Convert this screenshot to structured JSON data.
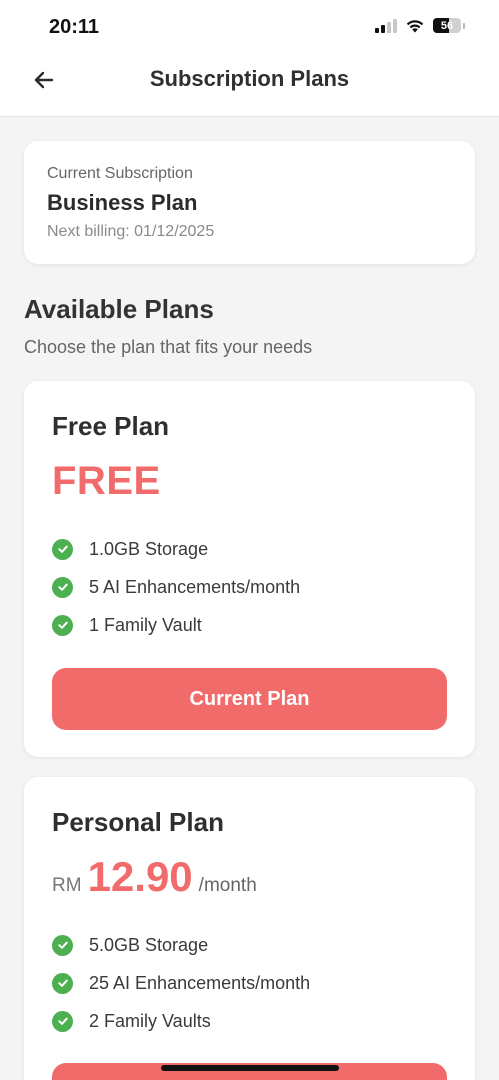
{
  "status_bar": {
    "time": "20:11",
    "battery": "56",
    "battery_level": 0.56
  },
  "header": {
    "title": "Subscription Plans",
    "back_icon": "arrow-left-icon"
  },
  "current_subscription": {
    "label": "Current Subscription",
    "plan": "Business Plan",
    "billing": "Next billing: 01/12/2025"
  },
  "available": {
    "title": "Available Plans",
    "subtitle": "Choose the plan that fits your needs"
  },
  "plans": [
    {
      "name": "Free Plan",
      "price": "FREE",
      "features": [
        "1.0GB Storage",
        "5 AI Enhancements/month",
        "1 Family Vault"
      ],
      "button": "Current Plan"
    },
    {
      "name": "Personal Plan",
      "currency": "RM",
      "price": "12.90",
      "period": "/month",
      "features": [
        "5.0GB Storage",
        "25 AI Enhancements/month",
        "2 Family Vaults"
      ],
      "button": ""
    }
  ],
  "colors": {
    "accent": "#f26b6b",
    "check": "#4caf50",
    "background": "#f4f4f5"
  }
}
